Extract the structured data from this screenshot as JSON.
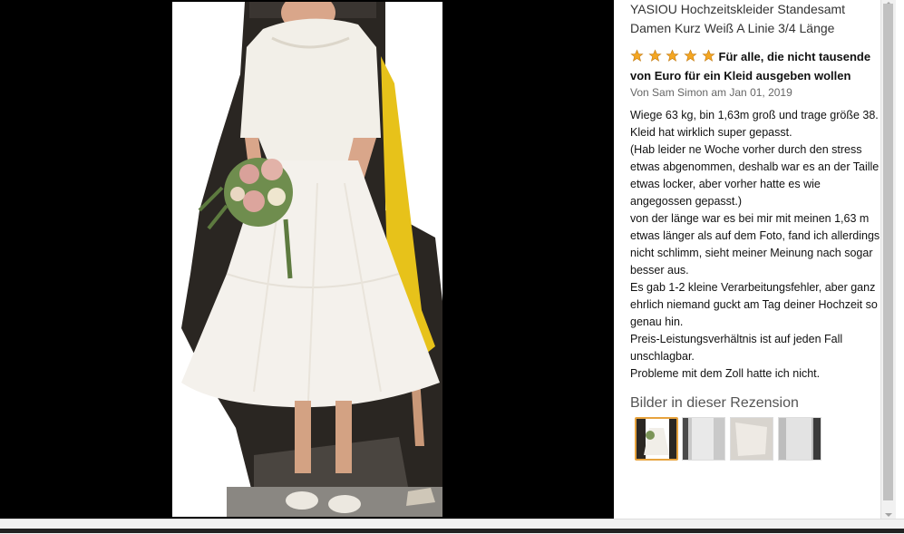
{
  "product": {
    "title": "YASIOU Hochzeitskleider Standesamt Damen Kurz Weiß A Linie 3/4 Länge"
  },
  "review": {
    "stars": 5,
    "headline": "Für alle, die nicht tausende von Euro für ein Kleid ausgeben wollen",
    "byline": "Von Sam Simon am Jan 01, 2019",
    "paragraphs": [
      "Wiege 63 kg, bin 1,63m groß und trage größe 38.",
      "Kleid hat wirklich super gepasst.",
      "(Hab leider ne Woche vorher durch den stress etwas abgenommen, deshalb war es an der Taille etwas locker, aber vorher hatte es wie angegossen gepasst.)",
      "von der länge war es bei mir mit meinen 1,63 m etwas länger als auf dem Foto, fand ich allerdings nicht schlimm, sieht meiner Meinung nach sogar besser aus.",
      "Es gab 1-2 kleine Verarbeitungsfehler, aber ganz ehrlich niemand guckt am Tag deiner Hochzeit so genau hin.",
      "Preis-Leistungsverhältnis ist auf jeden Fall unschlagbar.",
      "Probleme mit dem Zoll hatte ich nicht."
    ]
  },
  "images_section": {
    "heading": "Bilder in dieser Rezension",
    "thumbnail_count": 4,
    "selected_index": 0
  },
  "colors": {
    "star": "#f4a622",
    "selected_border": "#e7a33e",
    "background_viewer": "#000000"
  }
}
